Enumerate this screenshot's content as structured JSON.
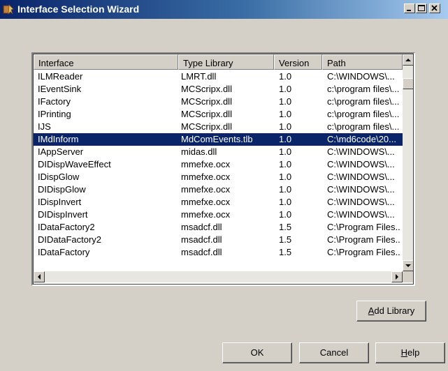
{
  "window": {
    "title": "Interface Selection Wizard",
    "icon": "wizard-app-icon",
    "controls": [
      "minimize-icon",
      "maximize-icon",
      "close-icon"
    ]
  },
  "list": {
    "columns": [
      "Interface",
      "Type Library",
      "Version",
      "Path"
    ],
    "rows": [
      [
        "ILMReader",
        "LMRT.dll",
        "1.0",
        "C:\\WINDOWS\\..."
      ],
      [
        "IEventSink",
        "MCScripx.dll",
        "1.0",
        "c:\\program files\\..."
      ],
      [
        "IFactory",
        "MCScripx.dll",
        "1.0",
        "c:\\program files\\..."
      ],
      [
        "IPrinting",
        "MCScripx.dll",
        "1.0",
        "c:\\program files\\..."
      ],
      [
        "IJS",
        "MCScripx.dll",
        "1.0",
        "c:\\program files\\..."
      ],
      [
        "IMdInform",
        "MdComEvents.tlb",
        "1.0",
        "C:\\md6code\\20..."
      ],
      [
        "IAppServer",
        "midas.dll",
        "1.0",
        "C:\\WINDOWS\\..."
      ],
      [
        "DIDispWaveEffect",
        "mmefxe.ocx",
        "1.0",
        "C:\\WINDOWS\\..."
      ],
      [
        "IDispGlow",
        "mmefxe.ocx",
        "1.0",
        "C:\\WINDOWS\\..."
      ],
      [
        "DIDispGlow",
        "mmefxe.ocx",
        "1.0",
        "C:\\WINDOWS\\..."
      ],
      [
        "IDispInvert",
        "mmefxe.ocx",
        "1.0",
        "C:\\WINDOWS\\..."
      ],
      [
        "DIDispInvert",
        "mmefxe.ocx",
        "1.0",
        "C:\\WINDOWS\\..."
      ],
      [
        "IDataFactory2",
        "msadcf.dll",
        "1.5",
        "C:\\Program Files..."
      ],
      [
        "DIDataFactory2",
        "msadcf.dll",
        "1.5",
        "C:\\Program Files..."
      ],
      [
        "IDataFactory",
        "msadcf.dll",
        "1.5",
        "C:\\Program Files..."
      ]
    ],
    "selected_row": "IMdInform",
    "vertical_scroll_position": 0.07
  },
  "buttons": {
    "add_library": {
      "pre": "",
      "accel": "A",
      "post": "dd Library"
    },
    "ok": "OK",
    "cancel": "Cancel",
    "help": {
      "pre": "",
      "accel": "H",
      "post": "elp"
    }
  },
  "colors": {
    "selection": "#0a246a",
    "face": "#d4d0c8",
    "title_gradient_start": "#0a246a",
    "title_gradient_end": "#a6caf0"
  }
}
